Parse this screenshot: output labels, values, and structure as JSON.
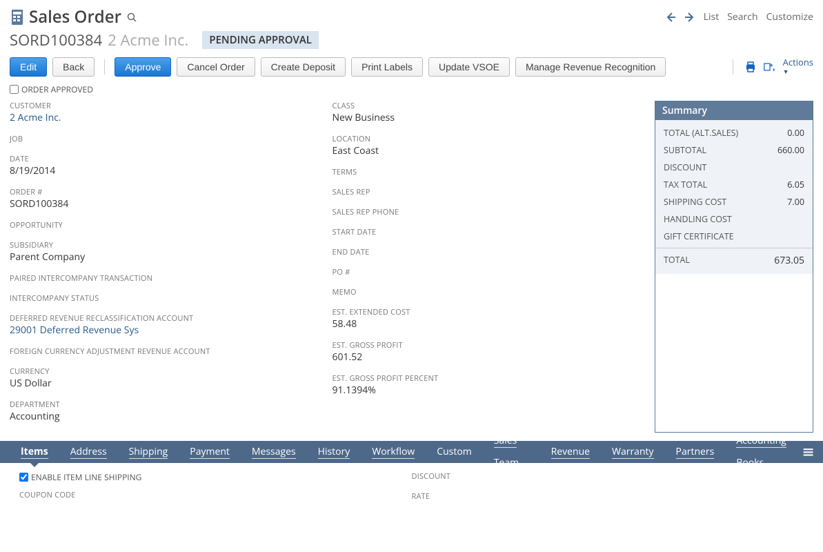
{
  "header": {
    "page_title": "Sales Order",
    "top_links": [
      "List",
      "Search",
      "Customize"
    ]
  },
  "record": {
    "order_number_display": "SORD100384",
    "customer_display": "2 Acme Inc.",
    "status": "PENDING APPROVAL"
  },
  "buttons": {
    "edit": "Edit",
    "back": "Back",
    "approve": "Approve",
    "cancel_order": "Cancel Order",
    "create_deposit": "Create Deposit",
    "print_labels": "Print Labels",
    "update_vsoe": "Update VSOE",
    "manage_rev": "Manage Revenue Recognition",
    "actions": "Actions"
  },
  "approved_check": {
    "label": "ORDER APPROVED"
  },
  "fields_left": {
    "customer": {
      "label": "CUSTOMER",
      "value": "2 Acme Inc."
    },
    "job": {
      "label": "JOB",
      "value": ""
    },
    "date": {
      "label": "DATE",
      "value": "8/19/2014"
    },
    "ordernum": {
      "label": "ORDER #",
      "value": "SORD100384"
    },
    "opportunity": {
      "label": "OPPORTUNITY",
      "value": ""
    },
    "subsidiary": {
      "label": "SUBSIDIARY",
      "value": "Parent Company"
    },
    "paired": {
      "label": "PAIRED INTERCOMPANY TRANSACTION",
      "value": ""
    },
    "icstatus": {
      "label": "INTERCOMPANY STATUS",
      "value": ""
    },
    "defrev": {
      "label": "DEFERRED REVENUE RECLASSIFICATION ACCOUNT",
      "value": "29001 Deferred Revenue Sys"
    },
    "fxrev": {
      "label": "FOREIGN CURRENCY ADJUSTMENT REVENUE ACCOUNT",
      "value": ""
    },
    "currency": {
      "label": "CURRENCY",
      "value": "US Dollar"
    },
    "department": {
      "label": "DEPARTMENT",
      "value": "Accounting"
    }
  },
  "fields_right": {
    "class": {
      "label": "CLASS",
      "value": "New Business"
    },
    "location": {
      "label": "LOCATION",
      "value": "East Coast"
    },
    "terms": {
      "label": "TERMS",
      "value": ""
    },
    "salesrep": {
      "label": "SALES REP",
      "value": ""
    },
    "salesrepphone": {
      "label": "SALES REP PHONE",
      "value": ""
    },
    "startdate": {
      "label": "START DATE",
      "value": ""
    },
    "enddate": {
      "label": "END DATE",
      "value": ""
    },
    "po": {
      "label": "PO #",
      "value": ""
    },
    "memo": {
      "label": "MEMO",
      "value": ""
    },
    "estcost": {
      "label": "EST. EXTENDED COST",
      "value": "58.48"
    },
    "estgross": {
      "label": "EST. GROSS PROFIT",
      "value": "601.52"
    },
    "estgrosspct": {
      "label": "EST. GROSS PROFIT PERCENT",
      "value": "91.1394%"
    }
  },
  "summary": {
    "title": "Summary",
    "rows": [
      {
        "label": "TOTAL (ALT.SALES)",
        "value": "0.00"
      },
      {
        "label": "SUBTOTAL",
        "value": "660.00"
      },
      {
        "label": "DISCOUNT",
        "value": ""
      },
      {
        "label": "TAX TOTAL",
        "value": "6.05"
      },
      {
        "label": "SHIPPING COST",
        "value": "7.00"
      },
      {
        "label": "HANDLING COST",
        "value": ""
      },
      {
        "label": "GIFT CERTIFICATE",
        "value": ""
      }
    ],
    "total_label": "TOTAL",
    "total_value": "673.05"
  },
  "tabs": [
    "Items",
    "Address",
    "Shipping",
    "Payment",
    "Messages",
    "History",
    "Workflow",
    "Custom",
    "Sales Team",
    "Revenue",
    "Warranty",
    "Partners",
    "Accounting Books"
  ],
  "subpanel": {
    "enable_shipping": "ENABLE ITEM LINE SHIPPING",
    "coupon": "COUPON CODE",
    "discount": "DISCOUNT",
    "rate": "RATE"
  }
}
